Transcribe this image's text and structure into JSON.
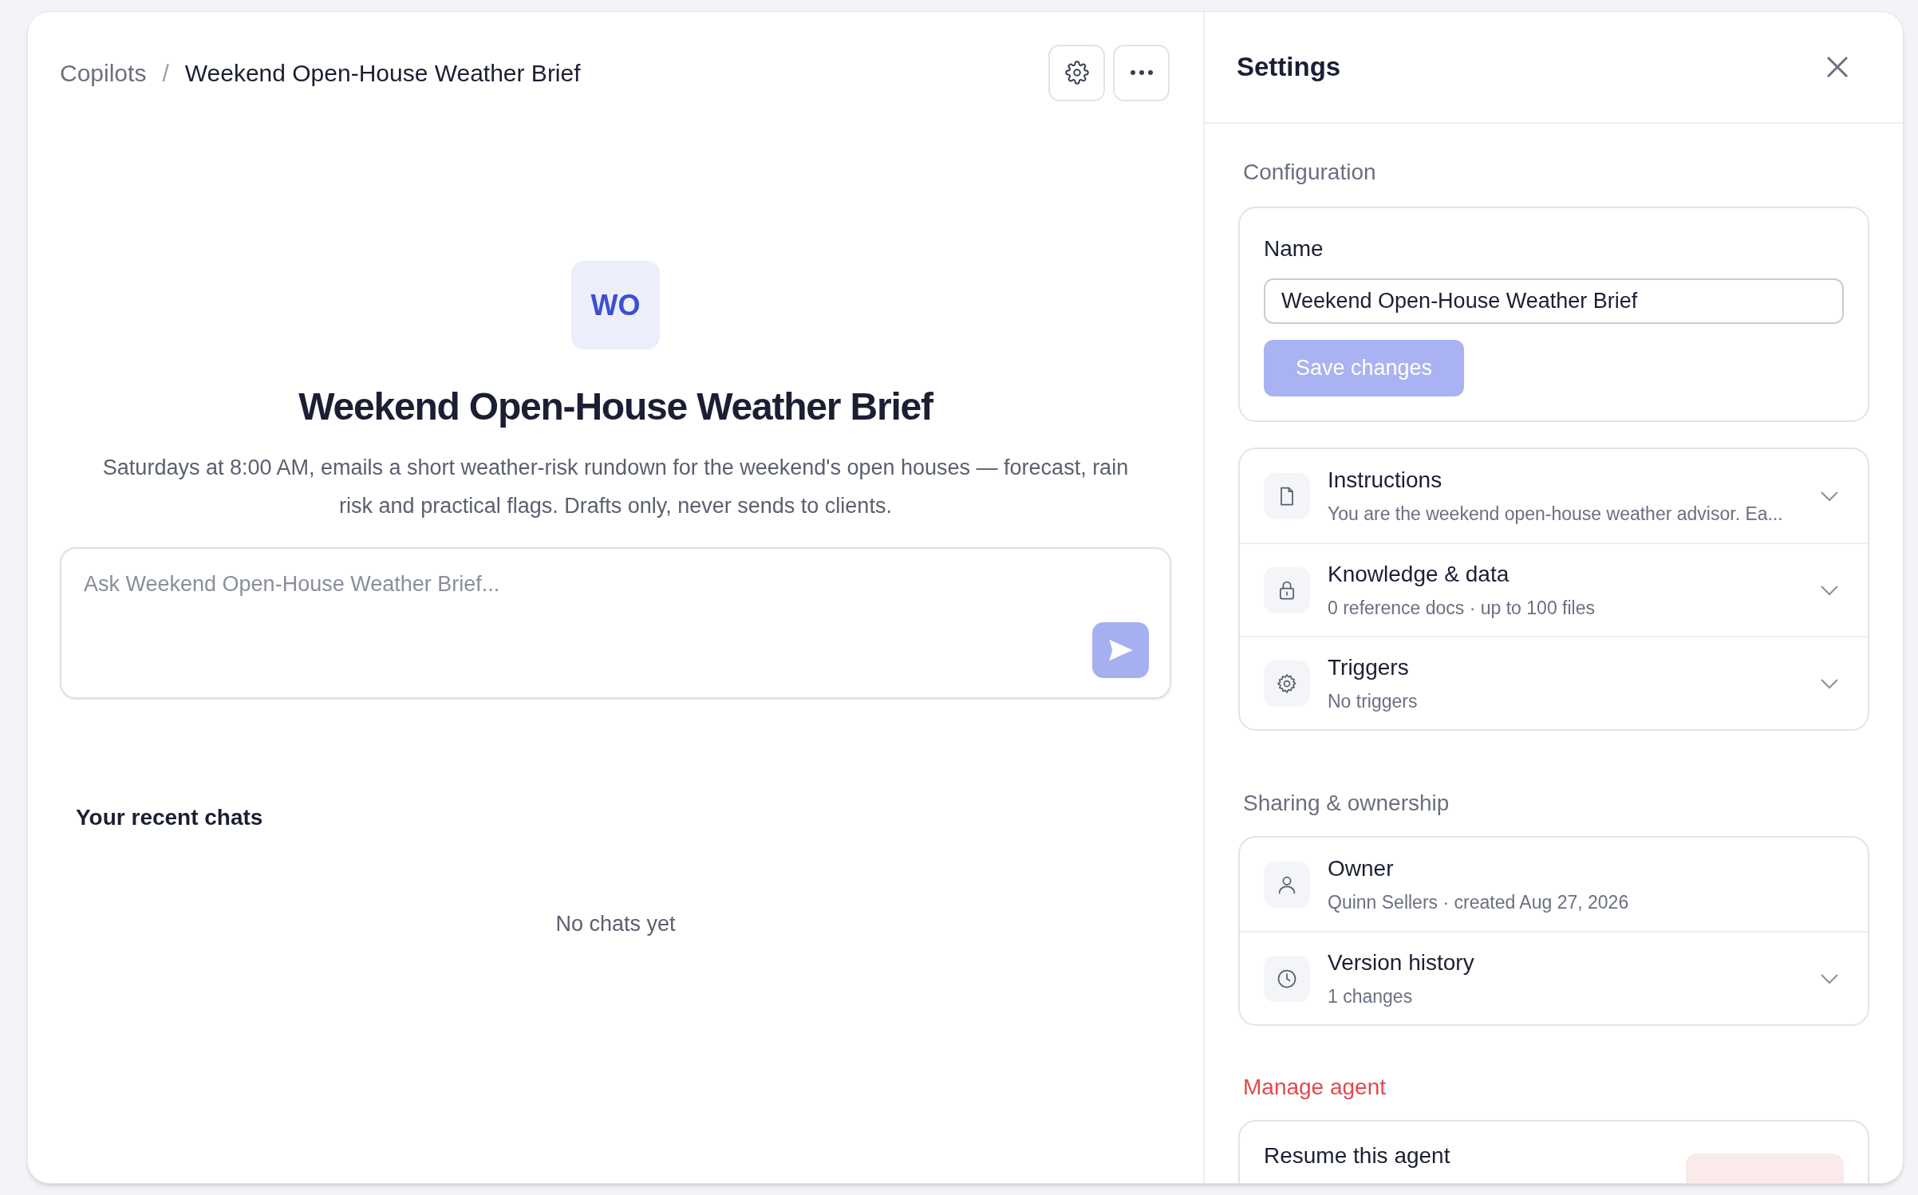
{
  "breadcrumb": [
    {
      "label": "Copilots",
      "current": false
    },
    {
      "label": "Weekend Open-House Weather Brief",
      "current": true
    }
  ],
  "breadcrumb_separator": "/",
  "agent": {
    "initials": "WO",
    "title": "Weekend Open-House Weather Brief",
    "description": "Saturdays at 8:00 AM, emails a short weather-risk rundown for the weekend's open houses — forecast, rain risk and practical flags. Drafts only, never sends to clients."
  },
  "chat_input": {
    "placeholder": "Ask Weekend Open-House Weather Brief...",
    "send_disabled": true
  },
  "recent_chats": {
    "heading": "Your recent chats",
    "empty_text": "No chats yet"
  },
  "settings": {
    "title": "Settings",
    "configuration": {
      "heading": "Configuration",
      "name_label": "Name",
      "name_value": "Weekend Open-House Weather Brief",
      "save_button": {
        "label": "Save changes",
        "disabled": true
      }
    },
    "config_items": [
      {
        "kind": "document",
        "title": "Instructions",
        "subtitle": "You are the weekend open-house weather advisor. Ea...",
        "expandable": true
      },
      {
        "kind": "lock",
        "title": "Knowledge & data",
        "subtitle": "0 reference docs · up to 100 files",
        "expandable": true
      },
      {
        "kind": "gear",
        "title": "Triggers",
        "subtitle": "No triggers",
        "expandable": true
      }
    ],
    "sharing": {
      "heading": "Sharing & ownership",
      "items": [
        {
          "kind": "person",
          "title": "Owner",
          "subtitle": "Quinn Sellers · created Aug 27, 2026",
          "expandable": false
        },
        {
          "kind": "clock",
          "title": "Version history",
          "subtitle": "1 changes",
          "expandable": true
        }
      ]
    },
    "manage": {
      "heading": "Manage agent",
      "items": [
        {
          "title": "Resume this agent",
          "action_button": true
        }
      ]
    }
  }
}
